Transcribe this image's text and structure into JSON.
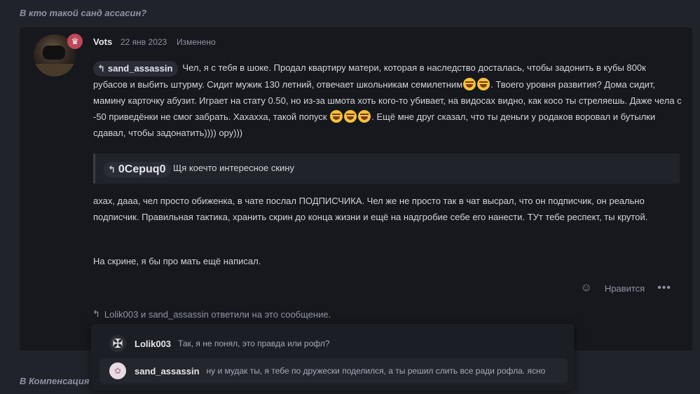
{
  "thread": {
    "title": "В кто такой санд ассасин?",
    "next_title": "В Компенсация з"
  },
  "post": {
    "author": "Vots",
    "date": "22 янв 2023",
    "edited": "Изменено",
    "mention": "sand_assassin",
    "body_part1": "Чел, я с тебя в шоке. Продал квартиру матери, которая в наследство досталась, чтобы задонить в кубы 800к рубасов и выбить штурму. Сидит мужик 130 летний, отвечает школьникам семилетним",
    "body_part2": ". Твоего уровня развития? Дома сидит, мамину карточку абузит. Играет на стату 0.50, но из-за шмота хоть кого-то убивает, на видосах видно, как косо ты стреляешь. Даже чела с -50 приведёнки не смог забрать. Хахахха, такой попуск ",
    "body_part3": ". Ещё мне друг сказал, что ты деньги у родаков воровал и бутылки сдавал, чтобы задонатить)))) ору)))",
    "quote_mention": "0Cepuq0",
    "quote_text": "Щя коечто интересное скину",
    "paragraph2": "ахах, дааа, чел просто обиженка, в чате послал ПОДПИСЧИКА. Чел же не просто так в чат высрал, что он подписчик, он реально подписчик. Правильная тактика, хранить скрин до конца жизни и ещё на надгробие себе его нанести. ТУт тебе респект, ты крутой.",
    "paragraph3": "На скрине, я бы про мать ещё написал.",
    "like_label": "Нравится",
    "more_label": "•••",
    "replied_text": "Lolik003 и sand_assassin ответили на это сообщение."
  },
  "replies": [
    {
      "name": "Lolik003",
      "text": "Так, я не понял, это правда или рофл?",
      "avatar_color": "#2a2c33"
    },
    {
      "name": "sand_assassin",
      "text": "ну и мудак ты, я тебе по дружески поделился, а ты решил слить все ради рофла. ясно",
      "avatar_color": "#e9dbe3"
    }
  ],
  "colors": {
    "background": "#21232b",
    "post_background": "#17181e",
    "badge": "#c04758",
    "muted_text": "#8f94a3"
  },
  "icons": [
    "reply-icon",
    "react-icon",
    "more-icon",
    "role-badge-icon",
    "emoji-laugh-icon"
  ]
}
